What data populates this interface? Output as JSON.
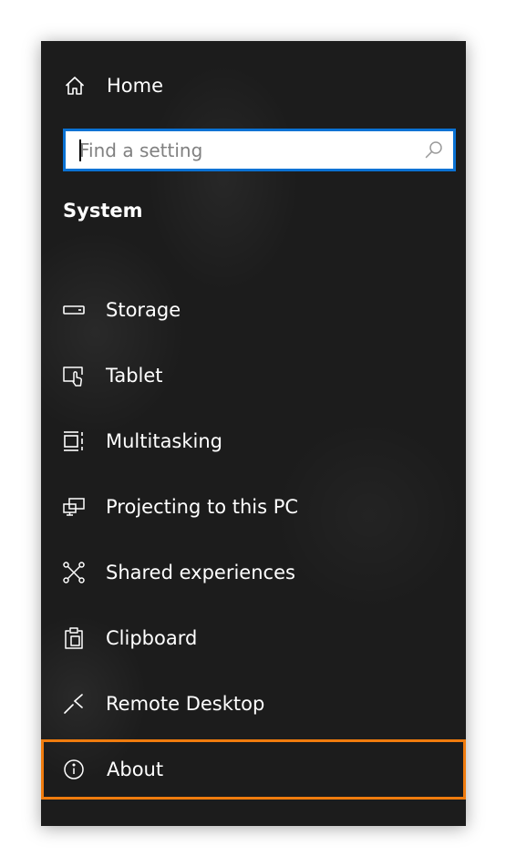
{
  "nav": {
    "home_label": "Home",
    "home_icon": "home-icon"
  },
  "search": {
    "placeholder": "Find a setting",
    "value": "",
    "icon": "search-icon"
  },
  "section": {
    "title": "System"
  },
  "items": [
    {
      "label": "Storage",
      "icon": "storage-icon"
    },
    {
      "label": "Tablet",
      "icon": "tablet-icon"
    },
    {
      "label": "Multitasking",
      "icon": "multitasking-icon"
    },
    {
      "label": "Projecting to this PC",
      "icon": "projecting-icon"
    },
    {
      "label": "Shared experiences",
      "icon": "shared-experiences-icon"
    },
    {
      "label": "Clipboard",
      "icon": "clipboard-icon"
    },
    {
      "label": "Remote Desktop",
      "icon": "remote-desktop-icon"
    },
    {
      "label": "About",
      "icon": "info-icon",
      "highlighted": true
    }
  ],
  "colors": {
    "panel_background": "#1c1c1c",
    "text": "#ffffff",
    "search_border": "#0a72d4",
    "highlight_outline": "#f07c0e"
  }
}
